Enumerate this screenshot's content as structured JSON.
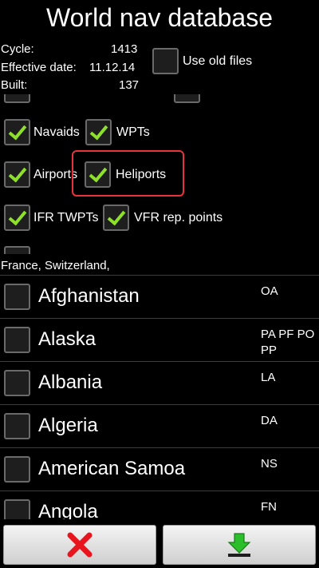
{
  "header": {
    "title": "World nav database"
  },
  "info": {
    "cycle_label": "Cycle:",
    "cycle_value": "1413",
    "effective_label": "Effective date:",
    "effective_value": "11.12.14",
    "built_label": "Built:",
    "built_value": "137"
  },
  "options": {
    "use_old_files": {
      "label": "Use old files",
      "checked": false
    },
    "navaids": {
      "label": "Navaids",
      "checked": true
    },
    "wpts": {
      "label": "WPTs",
      "checked": true
    },
    "airports": {
      "label": "Airports",
      "checked": true
    },
    "heliports": {
      "label": "Heliports",
      "checked": true
    },
    "ifr_twpts": {
      "label": "IFR TWPTs",
      "checked": true
    },
    "vfr_rep_points": {
      "label": "VFR rep. points",
      "checked": true
    }
  },
  "countries_header": "France, Switzerland,",
  "countries": [
    {
      "name": "Afghanistan",
      "code": "OA",
      "checked": false
    },
    {
      "name": "Alaska",
      "code": "PA PF PO PP",
      "checked": false
    },
    {
      "name": "Albania",
      "code": "LA",
      "checked": false
    },
    {
      "name": "Algeria",
      "code": "DA",
      "checked": false
    },
    {
      "name": "American Samoa",
      "code": "NS",
      "checked": false
    },
    {
      "name": "Angola",
      "code": "FN",
      "checked": false
    }
  ],
  "buttons": {
    "cancel_icon": "red-x-icon",
    "download_icon": "green-download-arrow-icon"
  },
  "colors": {
    "check": "#8ee02a",
    "cancel": "#e8141e",
    "download": "#2bbf2b",
    "highlight": "#e8323c"
  }
}
